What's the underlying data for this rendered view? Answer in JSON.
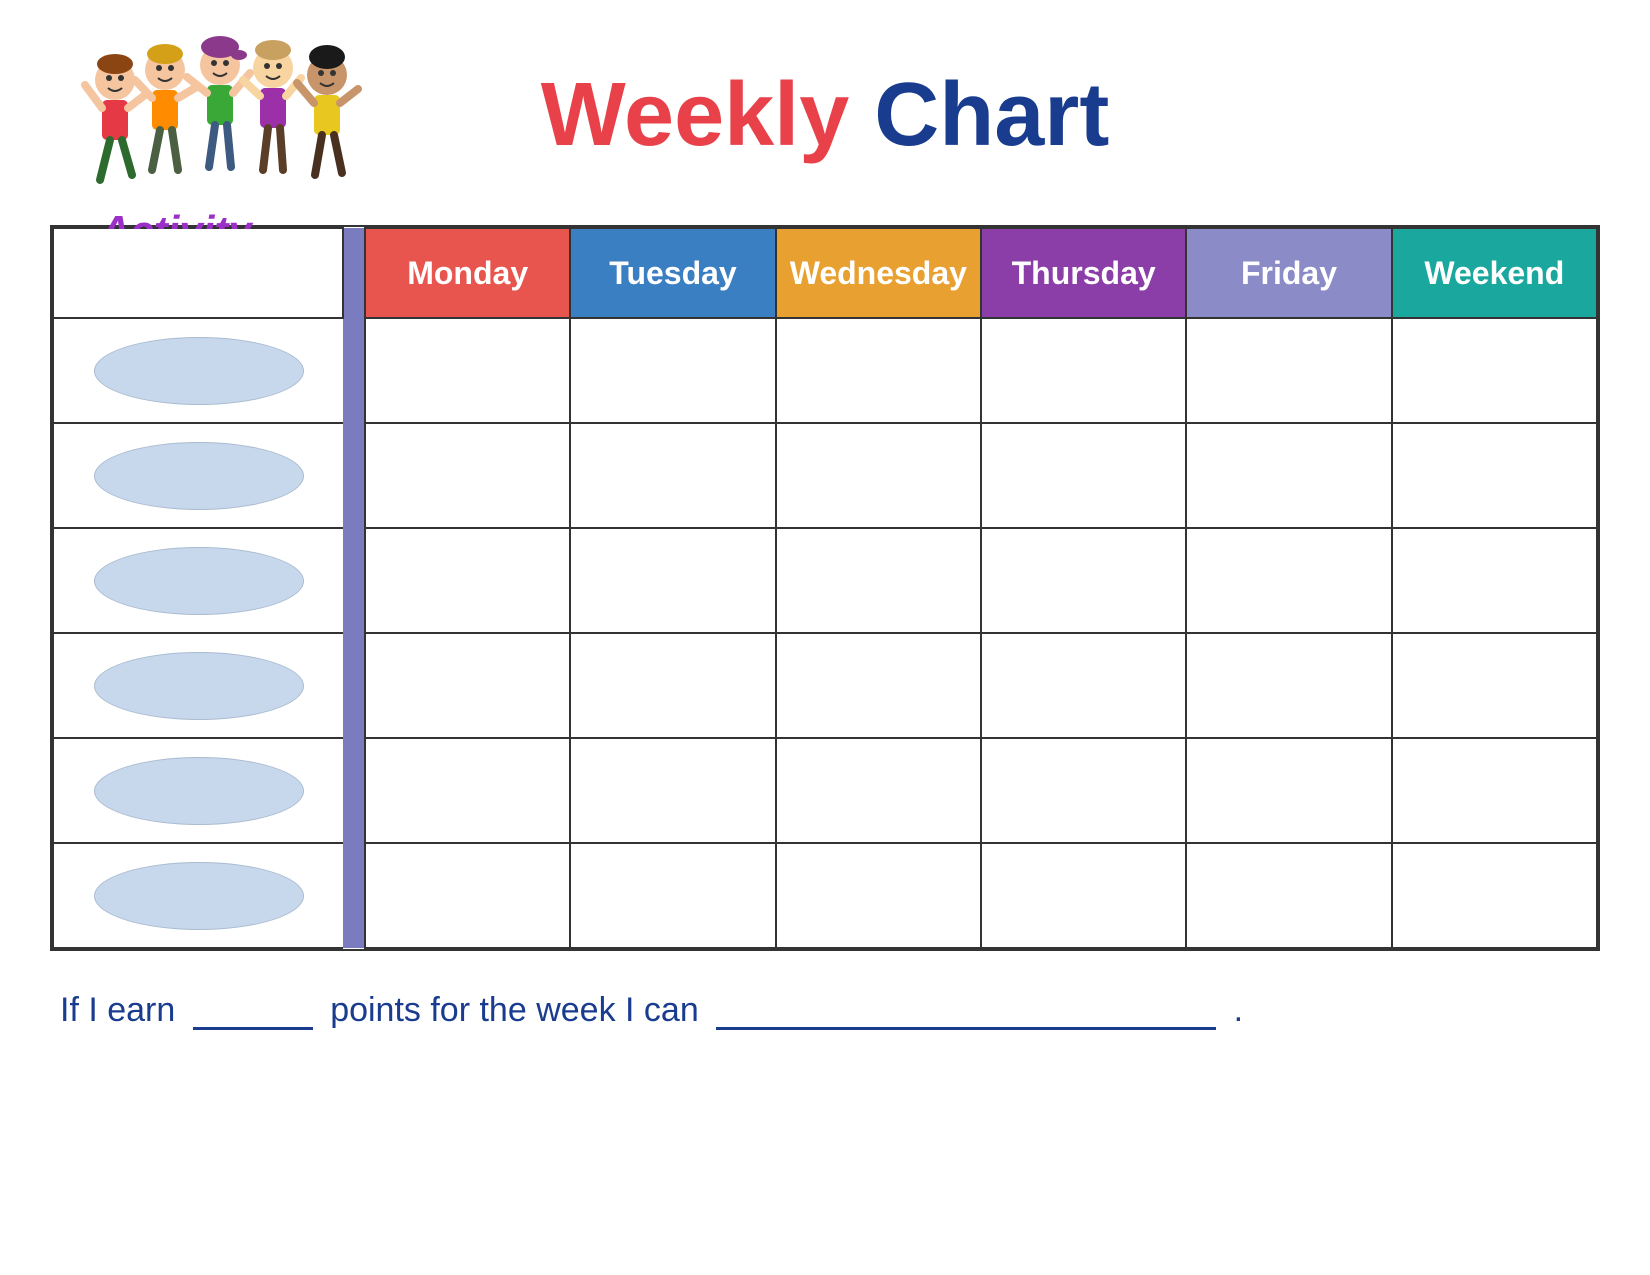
{
  "title": {
    "weekly": "Weekly",
    "chart": "Chart"
  },
  "activity_label": "Activity",
  "days": {
    "monday": "Monday",
    "tuesday": "Tuesday",
    "wednesday": "Wednesday",
    "thursday": "Thursday",
    "friday": "Friday",
    "weekend": "Weekend"
  },
  "rows": [
    {
      "id": 1
    },
    {
      "id": 2
    },
    {
      "id": 3
    },
    {
      "id": 4
    },
    {
      "id": 5
    },
    {
      "id": 6
    }
  ],
  "bottom_text": {
    "part1": "If I earn",
    "part2": "points for the week I can",
    "period": "."
  },
  "colors": {
    "monday": "#e8554e",
    "tuesday": "#3a7fc1",
    "wednesday": "#e8a030",
    "thursday": "#8b3ea8",
    "friday": "#8b8bc8",
    "weekend": "#1aa89e",
    "divider": "#7b7bbf",
    "activity": "#9b30c8",
    "title_weekly": "#e8414a",
    "title_chart": "#1a3c8f",
    "oval_fill": "#c8d8ec"
  }
}
